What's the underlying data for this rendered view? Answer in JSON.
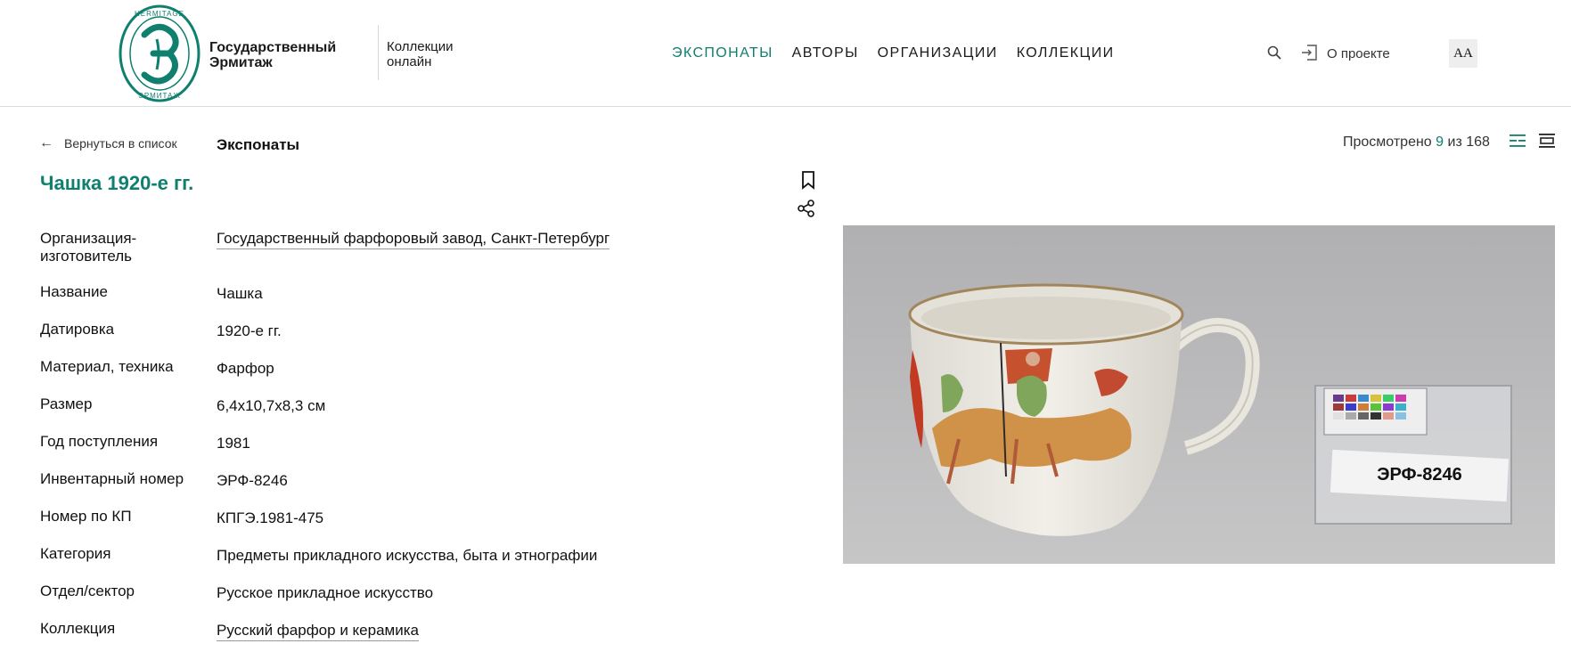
{
  "header": {
    "logo_ring_text": "HERMITAGE ЭРМИТАЖ",
    "brand_line1": "Государственный",
    "brand_line2": "Эрмитаж",
    "collections_line1": "Коллекции",
    "collections_line2": "онлайн",
    "nav": [
      "ЭКСПОНАТЫ",
      "АВТОРЫ",
      "ОРГАНИЗАЦИИ",
      "КОЛЛЕКЦИИ"
    ],
    "nav_active_index": 0,
    "search_icon": "search-icon",
    "login_icon": "login-icon",
    "about_label": "О проекте",
    "font_size_label": "AA"
  },
  "subheader": {
    "back_label": "Вернуться в список",
    "breadcrumb": "Экспонаты",
    "viewed_prefix": "Просмотрено",
    "viewed_current": "9",
    "viewed_mid": "из",
    "viewed_total": "168"
  },
  "item": {
    "title": "Чашка 1920-е гг.",
    "details": [
      {
        "label": "Организация-изготовитель",
        "value": "Государственный фарфоровый завод, Санкт-Петербург",
        "link": true
      },
      {
        "label": "Название",
        "value": "Чашка",
        "link": false
      },
      {
        "label": "Датировка",
        "value": "1920-е гг.",
        "link": false
      },
      {
        "label": "Материал, техника",
        "value": "Фарфор",
        "link": false
      },
      {
        "label": "Размер",
        "value": "6,4x10,7x8,3 см",
        "link": false
      },
      {
        "label": "Год поступления",
        "value": "1981",
        "link": false
      },
      {
        "label": "Инвентарный номер",
        "value": "ЭРФ-8246",
        "link": false
      },
      {
        "label": "Номер по КП",
        "value": "КПГЭ.1981-475",
        "link": false
      },
      {
        "label": "Категория",
        "value": "Предметы прикладного искусства, быта и этнографии",
        "link": false
      },
      {
        "label": "Отдел/сектор",
        "value": "Русское прикладное искусство",
        "link": false
      },
      {
        "label": "Коллекция",
        "value": "Русский фарфор и керамика",
        "link": true
      }
    ],
    "photo_label": "ЭРФ-8246"
  },
  "colors": {
    "accent": "#0f7f6e",
    "text": "#1a1a1a",
    "photo_bg": "#b9b9b9"
  }
}
